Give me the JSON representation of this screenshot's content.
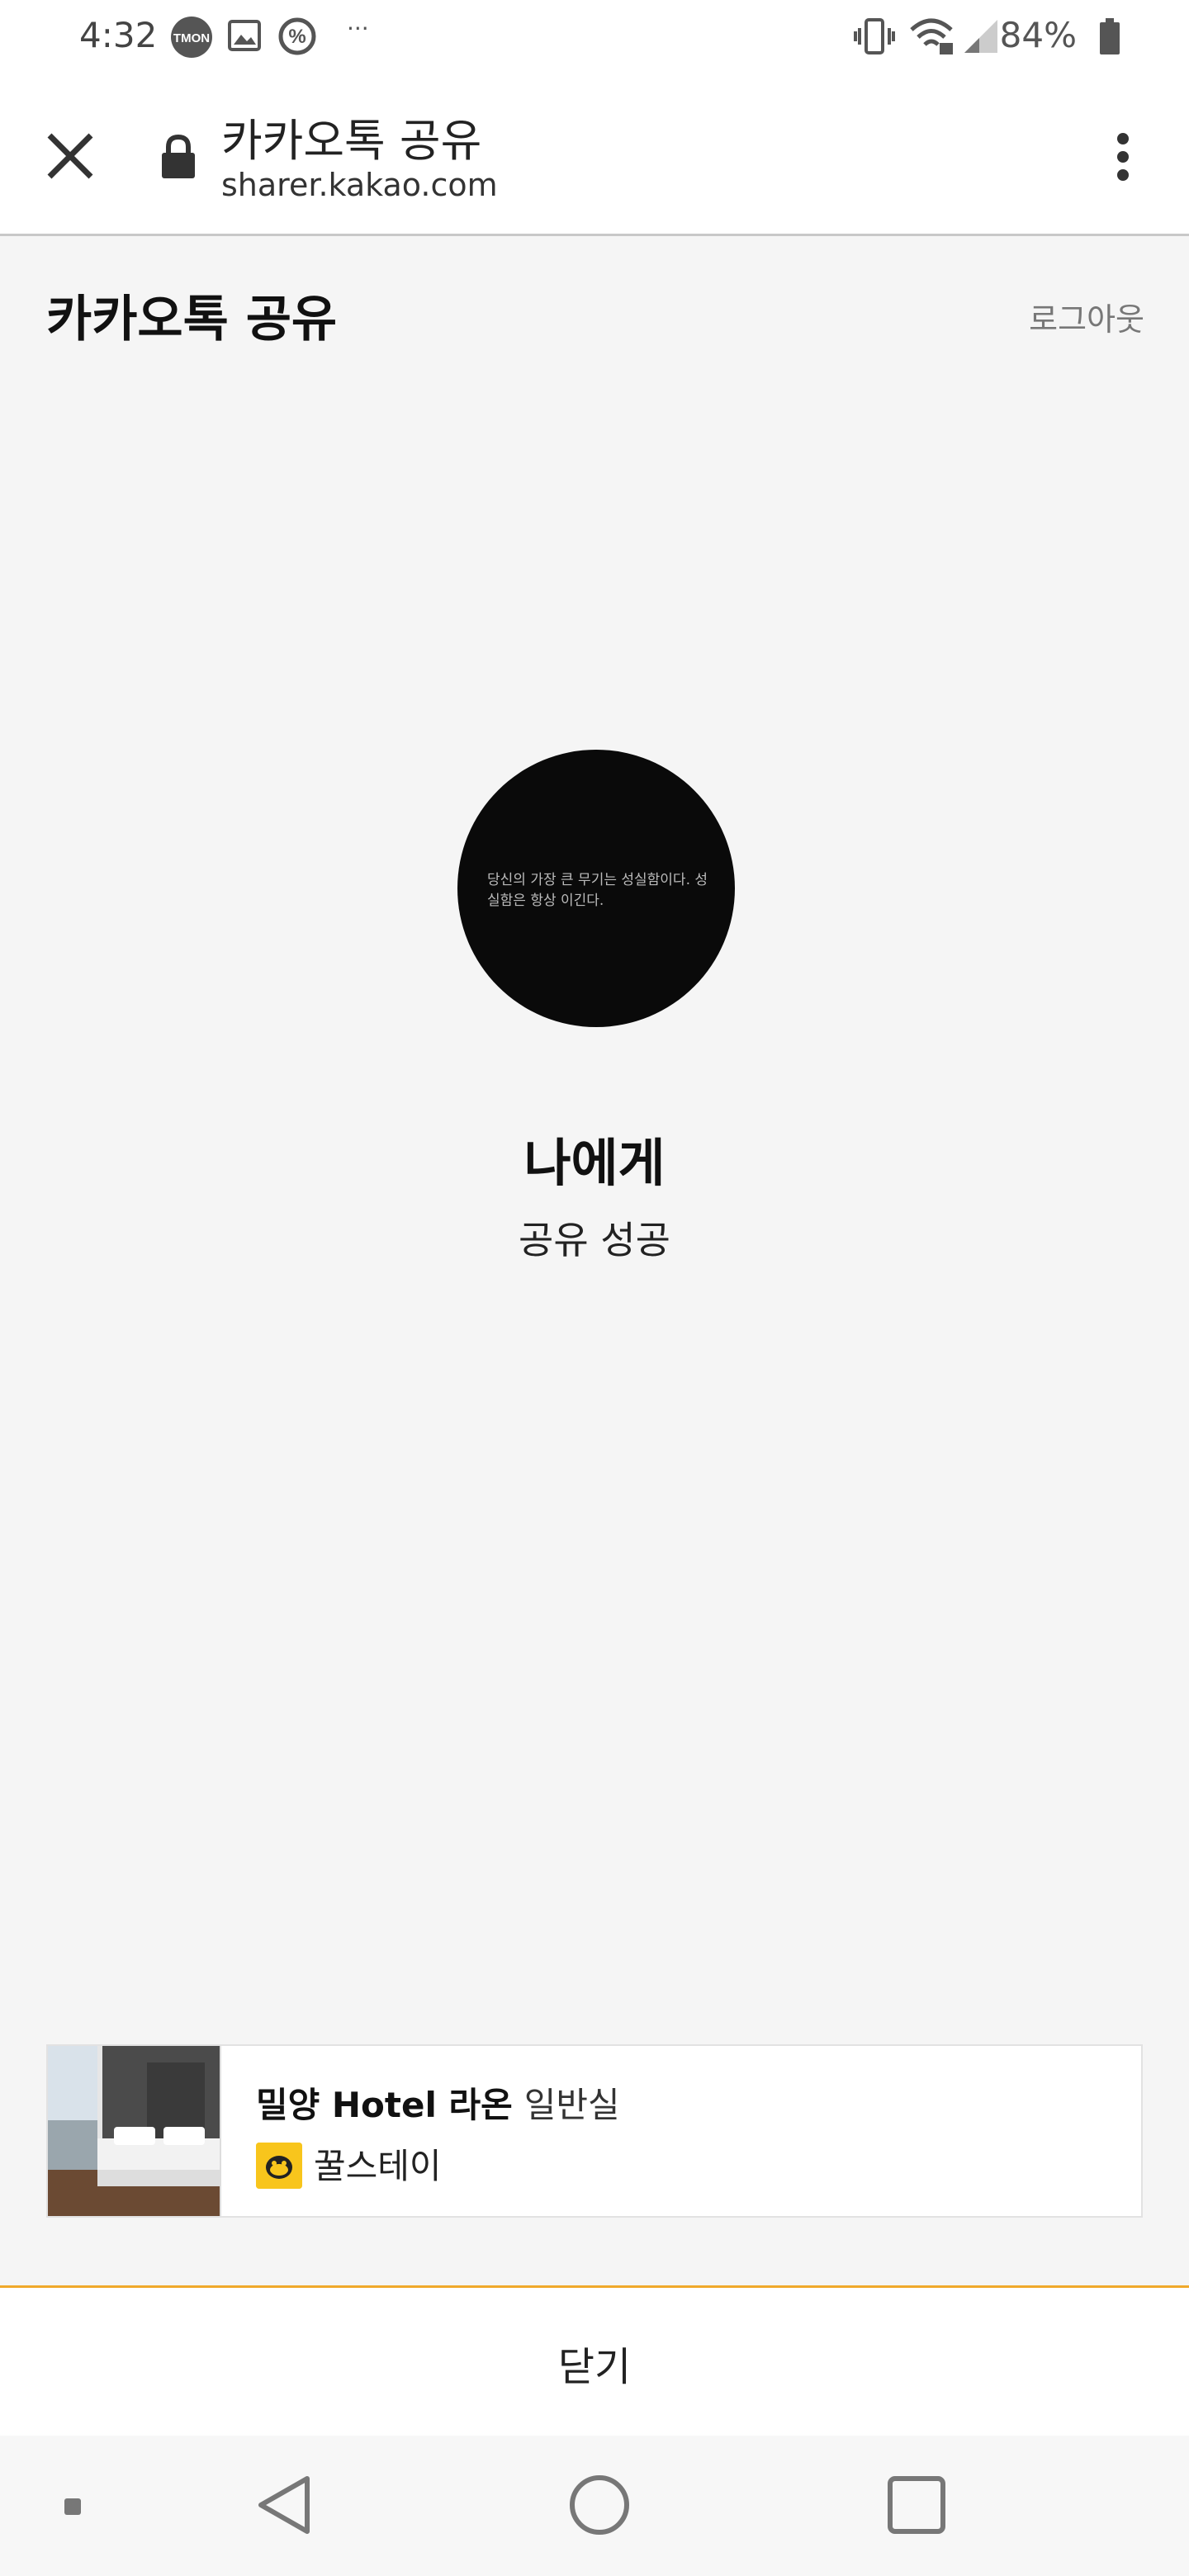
{
  "status_bar": {
    "time": "4:32",
    "battery": "84%",
    "app_badge": "TMON"
  },
  "toolbar": {
    "page_title": "카카오톡 공유",
    "url": "sharer.kakao.com"
  },
  "header": {
    "title": "카카오톡 공유",
    "logout": "로그아웃"
  },
  "profile": {
    "avatar_text": "당신의 가장 큰 무기는 성실함이다. 성실함은 항상 이긴다.",
    "recipient": "나에게",
    "status": "공유 성공"
  },
  "shared_card": {
    "title": "밀양 Hotel 라온",
    "subtitle": "일반실",
    "brand": "꿀스테이"
  },
  "footer": {
    "close_label": "닫기"
  },
  "colors": {
    "accent_border": "#f0a92b",
    "brand_yellow": "#f8c51c",
    "background": "#f5f5f5"
  }
}
